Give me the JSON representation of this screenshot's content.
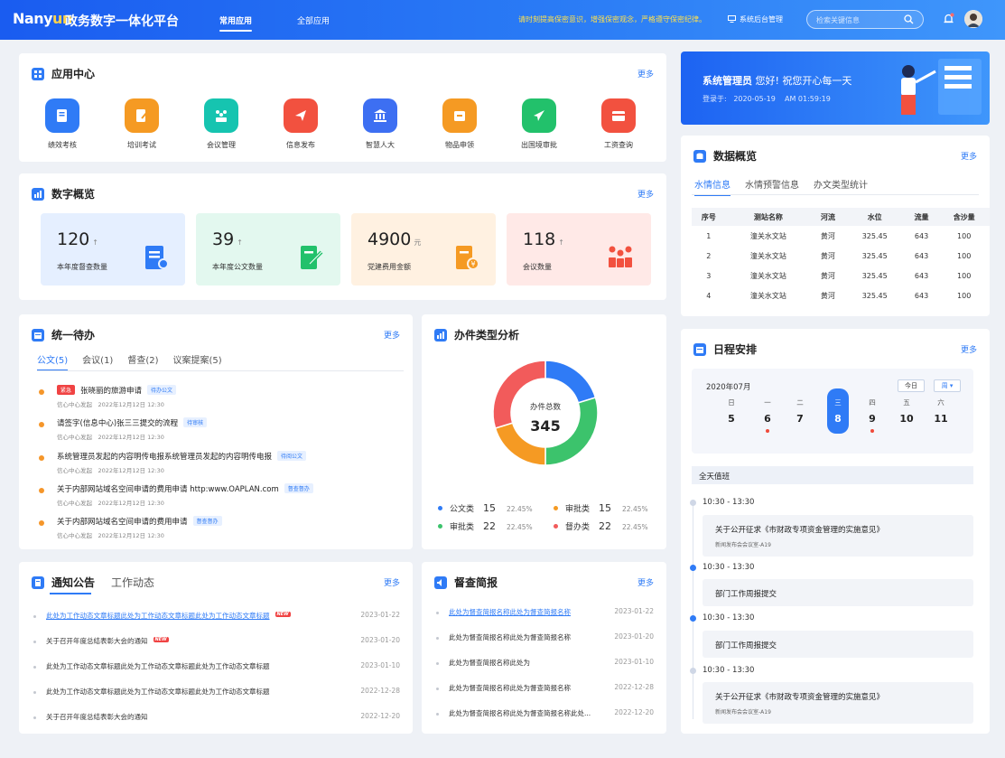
{
  "topbar": {
    "logo_main": "Nany",
    "logo_accent": "un",
    "logo_rest": "",
    "platform": "政务数字一体化平台",
    "nav_common": "常用应用",
    "nav_all": "全部应用",
    "slogan": "请时刻提高保密意识，增强保密观念，严格遵守保密纪律。",
    "admin_label": "系统后台管理",
    "search_placeholder": "检索关键信息"
  },
  "apps": {
    "title": "应用中心",
    "more": "更多",
    "items": [
      {
        "label": "绩效考核",
        "color": "#2f7bf6"
      },
      {
        "label": "培训考试",
        "color": "#f59a23"
      },
      {
        "label": "会议管理",
        "color": "#16c4b0"
      },
      {
        "label": "信息发布",
        "color": "#f2513f"
      },
      {
        "label": "智慧人大",
        "color": "#3d6ff2"
      },
      {
        "label": "物品申领",
        "color": "#f59a23"
      },
      {
        "label": "出国境审批",
        "color": "#22c16b"
      },
      {
        "label": "工资查询",
        "color": "#f2513f"
      }
    ]
  },
  "digits": {
    "title": "数字概览",
    "more": "更多",
    "items": [
      {
        "value": "120",
        "unit": "↑",
        "label": "本年度督查数量",
        "bg": "#e5efff",
        "accent": "#2f7bf6"
      },
      {
        "value": "39",
        "unit": "↑",
        "label": "本年度公文数量",
        "bg": "#e3f8ef",
        "accent": "#22c16b"
      },
      {
        "value": "4900",
        "unit": "元",
        "label": "党建费用金额",
        "bg": "#fff1e1",
        "accent": "#f59a23"
      },
      {
        "value": "118",
        "unit": "↑",
        "label": "会议数量",
        "bg": "#ffe9e7",
        "accent": "#f2513f"
      }
    ]
  },
  "todo": {
    "title": "统一待办",
    "more": "更多",
    "tabs": [
      "公文(5)",
      "会议(1)",
      "督查(2)",
      "议案提案(5)"
    ],
    "items": [
      {
        "urgent": "紧急",
        "title": "张晓丽的旅游申请",
        "tag": "待办公文",
        "meta": "信心中心发起　2022年12月12日 12:30"
      },
      {
        "urgent": "",
        "title": "请签字(信息中心)张三三提交的流程",
        "tag": "待审核",
        "meta": "信心中心发起　2022年12月12日 12:30"
      },
      {
        "urgent": "",
        "title": "系统管理员发起的内容明传电报系统管理员发起的内容明传电报",
        "tag": "待阅公文",
        "meta": "信心中心发起　2022年12月12日 12:30"
      },
      {
        "urgent": "",
        "title": "关于内部网站域名空间申请的费用申请 http:www.OAPLAN.com",
        "tag": "督查督办",
        "meta": "信心中心发起　2022年12月12日 12:30"
      },
      {
        "urgent": "",
        "title": "关于内部网站域名空间申请的费用申请",
        "tag": "督查督办",
        "meta": "信心中心发起　2022年12月12日 12:30"
      }
    ]
  },
  "analysis": {
    "title": "办件类型分析",
    "center_label": "办件总数",
    "center_value": "345",
    "legend": [
      {
        "name": "公文类",
        "value": "15",
        "pct": "22.45%",
        "color": "#2f7bf6"
      },
      {
        "name": "审批类",
        "value": "15",
        "pct": "22.45%",
        "color": "#f59a23"
      },
      {
        "name": "审批类",
        "value": "22",
        "pct": "22.45%",
        "color": "#3cc36c"
      },
      {
        "name": "督办类",
        "value": "22",
        "pct": "22.45%",
        "color": "#f25b5b"
      }
    ]
  },
  "notice": {
    "tabs": [
      "通知公告",
      "工作动态"
    ],
    "more": "更多",
    "items": [
      {
        "title": "此处为工作动态文章标题此处为工作动态文章标题此处为工作动态文章标题",
        "date": "2023-01-22",
        "link": true,
        "isnew": "NEW"
      },
      {
        "title": "关于召开年度总结表彰大会的通知",
        "date": "2023-01-20",
        "link": false,
        "isnew": "NEW"
      },
      {
        "title": "此处为工作动态文章标题此处为工作动态文章标题此处为工作动态文章标题",
        "date": "2023-01-10",
        "link": false,
        "isnew": ""
      },
      {
        "title": "此处为工作动态文章标题此处为工作动态文章标题此处为工作动态文章标题",
        "date": "2022-12-28",
        "link": false,
        "isnew": ""
      },
      {
        "title": "关于召开年度总结表彰大会的通知",
        "date": "2022-12-20",
        "link": false,
        "isnew": ""
      }
    ]
  },
  "brief": {
    "title": "督查简报",
    "more": "更多",
    "items": [
      {
        "title": "此处为督查简报名称此处为督查简报名称",
        "date": "2023-01-22",
        "link": true
      },
      {
        "title": "此处为督查简报名称此处为督查简报名称",
        "date": "2023-01-20",
        "link": false
      },
      {
        "title": "此处为督查简报名称此处为",
        "date": "2023-01-10",
        "link": false
      },
      {
        "title": "此处为督查简报名称此处为督查简报名称",
        "date": "2022-12-28",
        "link": false
      },
      {
        "title": "此处为督查简报名称此处为督查简报名称此处...",
        "date": "2022-12-20",
        "link": false
      }
    ]
  },
  "welcome": {
    "name": "系统管理员",
    "greeting": "您好! 祝您开心每一天",
    "login_label": "登录于:",
    "date": "2020-05-19",
    "time": "AM 01:59:19"
  },
  "data_overview": {
    "title": "数据概览",
    "more": "更多",
    "tabs": [
      "水情信息",
      "水情预警信息",
      "办文类型统计"
    ],
    "columns": [
      "序号",
      "测站名称",
      "河流",
      "水位",
      "流量",
      "含沙量"
    ],
    "rows": [
      [
        "1",
        "潼关水文站",
        "黄河",
        "325.45",
        "643",
        "100"
      ],
      [
        "2",
        "潼关水文站",
        "黄河",
        "325.45",
        "643",
        "100"
      ],
      [
        "3",
        "潼关水文站",
        "黄河",
        "325.45",
        "643",
        "100"
      ],
      [
        "4",
        "潼关水文站",
        "黄河",
        "325.45",
        "643",
        "100"
      ]
    ]
  },
  "schedule": {
    "title": "日程安排",
    "more": "更多",
    "month": "2020年07月",
    "today": "今日",
    "view": "周 ▾",
    "days": [
      {
        "w": "日",
        "n": "5",
        "red": false,
        "sel": false
      },
      {
        "w": "一",
        "n": "6",
        "red": true,
        "sel": false
      },
      {
        "w": "二",
        "n": "7",
        "red": false,
        "sel": false
      },
      {
        "w": "三",
        "n": "8",
        "red": false,
        "sel": true
      },
      {
        "w": "四",
        "n": "9",
        "red": true,
        "sel": false
      },
      {
        "w": "五",
        "n": "10",
        "red": false,
        "sel": false
      },
      {
        "w": "六",
        "n": "11",
        "red": false,
        "sel": false
      }
    ],
    "allday": "全天值班",
    "events": [
      {
        "time": "10:30 - 13:30",
        "title": "关于公开征求《市财政专项资金管理的实施意见》",
        "sub": "新闻发布会会议室-A19",
        "active": false
      },
      {
        "time": "10:30 - 13:30",
        "title": "部门工作周报提交",
        "sub": "",
        "active": true
      },
      {
        "time": "10:30 - 13:30",
        "title": "部门工作周报提交",
        "sub": "",
        "active": true
      },
      {
        "time": "10:30 - 13:30",
        "title": "关于公开征求《市财政专项资金管理的实施意见》",
        "sub": "新闻发布会会议室-A19",
        "active": false
      }
    ]
  }
}
